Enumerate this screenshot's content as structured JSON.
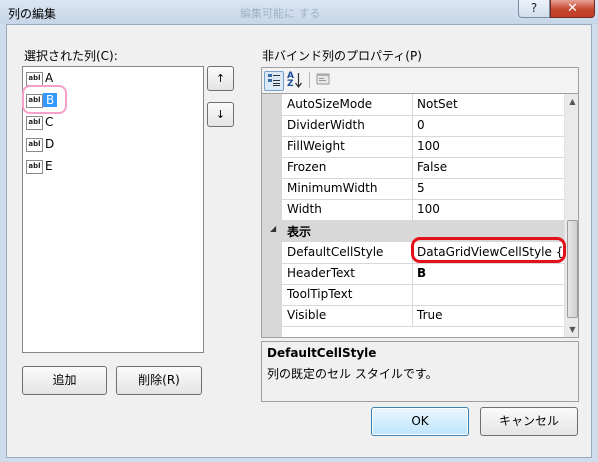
{
  "window": {
    "title": "列の編集",
    "ghost_title": "編集可能に する",
    "help_label": "?",
    "close_label": "✕"
  },
  "left_panel": {
    "label": "選択された列(C):",
    "icon_text": "abl",
    "columns": [
      {
        "label": "A",
        "selected": false
      },
      {
        "label": "B",
        "selected": true
      },
      {
        "label": "C",
        "selected": false
      },
      {
        "label": "D",
        "selected": false
      },
      {
        "label": "E",
        "selected": false
      }
    ],
    "add_label": "追加",
    "remove_label": "削除(R)",
    "up_icon": "↑",
    "down_icon": "↓"
  },
  "right_panel": {
    "label": "非バインド列のプロパティ(P)",
    "toolbar": {
      "categorized_icon": "categorized-icon",
      "alphabetical_icon": "alphabetical-icon",
      "pages_icon": "property-pages-icon",
      "alpha_top": "A",
      "alpha_bottom": "Z"
    },
    "properties_top": [
      {
        "name": "AutoSizeMode",
        "value": "NotSet"
      },
      {
        "name": "DividerWidth",
        "value": "0"
      },
      {
        "name": "FillWeight",
        "value": "100"
      },
      {
        "name": "Frozen",
        "value": "False"
      },
      {
        "name": "MinimumWidth",
        "value": "5"
      },
      {
        "name": "Width",
        "value": "100"
      }
    ],
    "category": {
      "label": "表示",
      "toggle": "◢"
    },
    "properties_display": [
      {
        "name": "DefaultCellStyle",
        "value": "DataGridViewCellStyle {"
      },
      {
        "name": "HeaderText",
        "value": "B",
        "bold": true
      },
      {
        "name": "ToolTipText",
        "value": ""
      },
      {
        "name": "Visible",
        "value": "True"
      }
    ],
    "description": {
      "title": "DefaultCellStyle",
      "text": "列の既定のセル スタイルです。"
    }
  },
  "buttons": {
    "ok": "OK",
    "cancel": "キャンセル"
  },
  "colors": {
    "selection": "#3399ff",
    "highlight_red": "#e4101a",
    "highlight_pink": "#f5a0c8"
  }
}
